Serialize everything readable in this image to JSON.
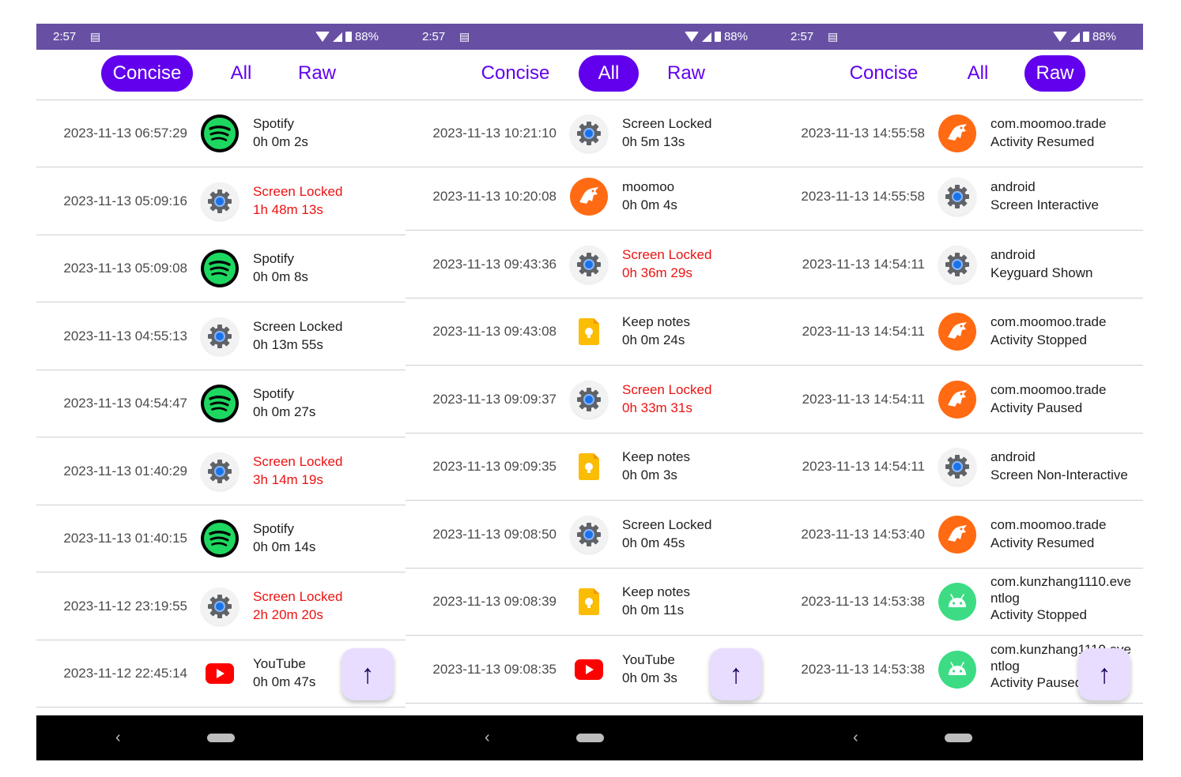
{
  "colors": {
    "accent": "#6200ee",
    "status_bar": "#6750a4",
    "red_text": "#ee1111",
    "fab_bg": "#e8ddff"
  },
  "phones": [
    {
      "status": {
        "time": "2:57",
        "battery": "88%"
      },
      "tabs": [
        "Concise",
        "All",
        "Raw"
      ],
      "active_tab": "Concise",
      "rows": [
        {
          "timestamp": "2023-11-13 06:57:29",
          "icon": "spotify-icon",
          "line1": "Spotify",
          "line2": "0h 0m 2s",
          "highlight": false
        },
        {
          "timestamp": "2023-11-13 05:09:16",
          "icon": "settings-gear-icon",
          "line1": "Screen Locked",
          "line2": "1h 48m 13s",
          "highlight": true
        },
        {
          "timestamp": "2023-11-13 05:09:08",
          "icon": "spotify-icon",
          "line1": "Spotify",
          "line2": "0h 0m 8s",
          "highlight": false
        },
        {
          "timestamp": "2023-11-13 04:55:13",
          "icon": "settings-gear-icon",
          "line1": "Screen Locked",
          "line2": "0h 13m 55s",
          "highlight": false
        },
        {
          "timestamp": "2023-11-13 04:54:47",
          "icon": "spotify-icon",
          "line1": "Spotify",
          "line2": "0h 0m 27s",
          "highlight": false
        },
        {
          "timestamp": "2023-11-13 01:40:29",
          "icon": "settings-gear-icon",
          "line1": "Screen Locked",
          "line2": "3h 14m 19s",
          "highlight": true
        },
        {
          "timestamp": "2023-11-13 01:40:15",
          "icon": "spotify-icon",
          "line1": "Spotify",
          "line2": "0h 0m 14s",
          "highlight": false
        },
        {
          "timestamp": "2023-11-12 23:19:55",
          "icon": "settings-gear-icon",
          "line1": "Screen Locked",
          "line2": "2h 20m 20s",
          "highlight": true
        },
        {
          "timestamp": "2023-11-12 22:45:14",
          "icon": "youtube-icon",
          "line1": "YouTube",
          "line2": "0h 0m 47s",
          "highlight": false
        }
      ],
      "fab_label": "↑"
    },
    {
      "status": {
        "time": "2:57",
        "battery": "88%"
      },
      "tabs": [
        "Concise",
        "All",
        "Raw"
      ],
      "active_tab": "All",
      "rows": [
        {
          "timestamp": "2023-11-13 10:21:10",
          "icon": "settings-gear-icon",
          "line1": "Screen Locked",
          "line2": "0h 5m 13s",
          "highlight": false
        },
        {
          "timestamp": "2023-11-13 10:20:08",
          "icon": "moomoo-icon",
          "line1": "moomoo",
          "line2": "0h 0m 4s",
          "highlight": false
        },
        {
          "timestamp": "2023-11-13 09:43:36",
          "icon": "settings-gear-icon",
          "line1": "Screen Locked",
          "line2": "0h 36m 29s",
          "highlight": true
        },
        {
          "timestamp": "2023-11-13 09:43:08",
          "icon": "keep-notes-icon",
          "line1": "Keep notes",
          "line2": "0h 0m 24s",
          "highlight": false
        },
        {
          "timestamp": "2023-11-13 09:09:37",
          "icon": "settings-gear-icon",
          "line1": "Screen Locked",
          "line2": "0h 33m 31s",
          "highlight": true
        },
        {
          "timestamp": "2023-11-13 09:09:35",
          "icon": "keep-notes-icon",
          "line1": "Keep notes",
          "line2": "0h 0m 3s",
          "highlight": false
        },
        {
          "timestamp": "2023-11-13 09:08:50",
          "icon": "settings-gear-icon",
          "line1": "Screen Locked",
          "line2": "0h 0m 45s",
          "highlight": false
        },
        {
          "timestamp": "2023-11-13 09:08:39",
          "icon": "keep-notes-icon",
          "line1": "Keep notes",
          "line2": "0h 0m 11s",
          "highlight": false
        },
        {
          "timestamp": "2023-11-13 09:08:35",
          "icon": "youtube-icon",
          "line1": "YouTube",
          "line2": "0h 0m 3s",
          "highlight": false
        }
      ],
      "fab_label": "↑"
    },
    {
      "status": {
        "time": "2:57",
        "battery": "88%"
      },
      "tabs": [
        "Concise",
        "All",
        "Raw"
      ],
      "active_tab": "Raw",
      "rows": [
        {
          "timestamp": "2023-11-13 14:55:58",
          "icon": "moomoo-icon",
          "line1": "com.moomoo.trade",
          "line2": "Activity Resumed",
          "highlight": false
        },
        {
          "timestamp": "2023-11-13 14:55:58",
          "icon": "settings-gear-icon",
          "line1": "android",
          "line2": "Screen Interactive",
          "highlight": false
        },
        {
          "timestamp": "2023-11-13 14:54:11",
          "icon": "settings-gear-icon",
          "line1": "android",
          "line2": "Keyguard Shown",
          "highlight": false
        },
        {
          "timestamp": "2023-11-13 14:54:11",
          "icon": "moomoo-icon",
          "line1": "com.moomoo.trade",
          "line2": "Activity Stopped",
          "highlight": false
        },
        {
          "timestamp": "2023-11-13 14:54:11",
          "icon": "moomoo-icon",
          "line1": "com.moomoo.trade",
          "line2": "Activity Paused",
          "highlight": false
        },
        {
          "timestamp": "2023-11-13 14:54:11",
          "icon": "settings-gear-icon",
          "line1": "android",
          "line2": "Screen Non-Interactive",
          "highlight": false
        },
        {
          "timestamp": "2023-11-13 14:53:40",
          "icon": "moomoo-icon",
          "line1": "com.moomoo.trade",
          "line2": "Activity Resumed",
          "highlight": false
        },
        {
          "timestamp": "2023-11-13 14:53:38",
          "icon": "android-icon",
          "line1": "com.kunzhang1110.eve",
          "line1b": "ntlog",
          "line2": "Activity Stopped",
          "highlight": false
        },
        {
          "timestamp": "2023-11-13 14:53:38",
          "icon": "android-icon",
          "line1": "com.kunzhang1110.eve",
          "line1b": "ntlog",
          "line2": "Activity Paused",
          "highlight": false
        }
      ],
      "fab_label": "↑"
    }
  ]
}
